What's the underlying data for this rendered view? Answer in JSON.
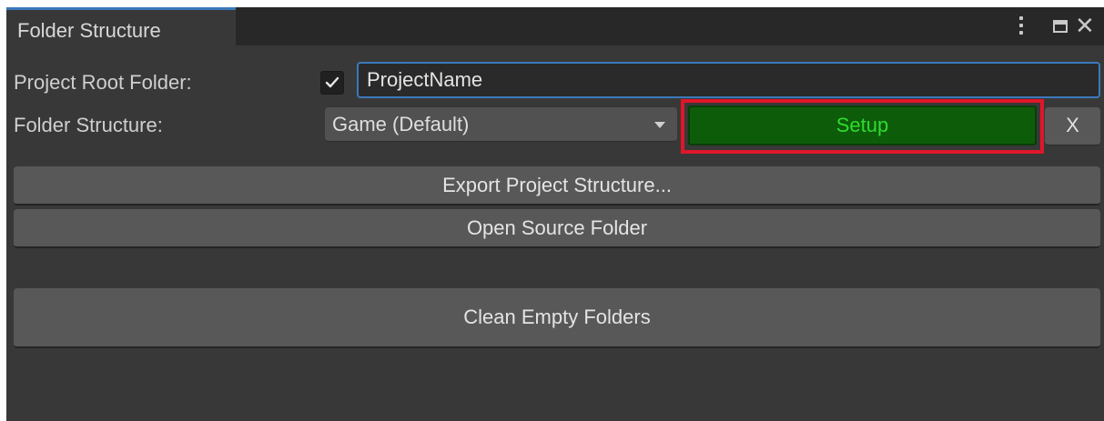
{
  "window": {
    "tab_title": "Folder Structure",
    "menu_icon": "kebab-menu-icon",
    "maximize_icon": "maximize-icon",
    "close_icon": "close-icon",
    "close_glyph": "✕"
  },
  "form": {
    "root_label": "Project Root Folder:",
    "root_enabled": true,
    "root_value": "ProjectName",
    "structure_label": "Folder Structure:",
    "structure_selected": "Game (Default)"
  },
  "buttons": {
    "setup": "Setup",
    "clear": "X",
    "export": "Export Project Structure...",
    "open_source": "Open Source Folder",
    "clean": "Clean Empty Folders"
  },
  "colors": {
    "setup_bg": "#0d5c0a",
    "setup_text": "#2fdc2f",
    "highlight": "#e0162a",
    "focus": "#3a79bb"
  }
}
